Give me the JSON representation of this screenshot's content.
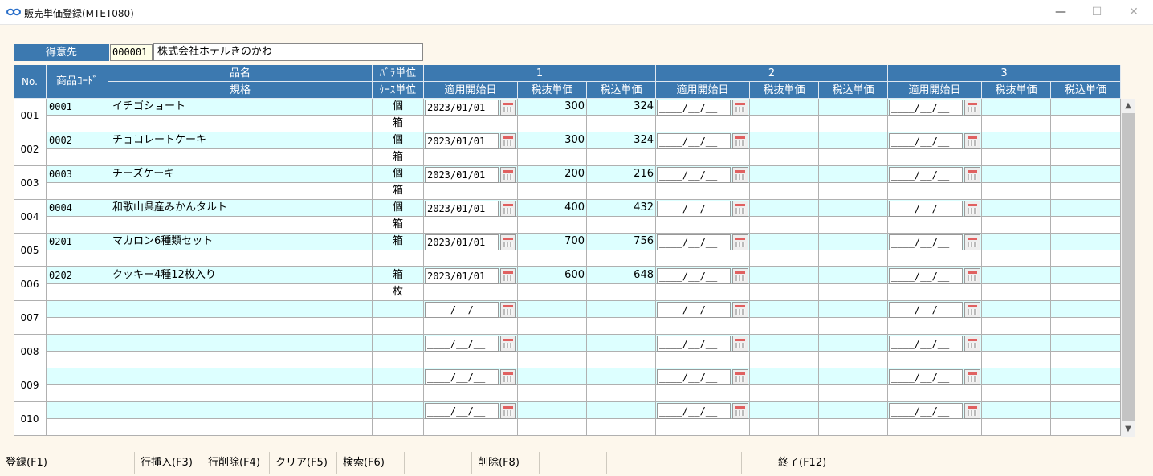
{
  "window": {
    "title": "販売単価登録(MTET080)",
    "min": "—",
    "max": "☐",
    "close": "✕"
  },
  "customer": {
    "label": "得意先",
    "code": "000001",
    "name": "株式会社ホテルきのかわ"
  },
  "headers": {
    "no": "No.",
    "code": "商品ｺｰﾄﾞ",
    "name": "品名",
    "spec": "規格",
    "unit_piece": "ﾊﾞﾗ単位",
    "unit_case": "ｹｰｽ単位",
    "groups": [
      "1",
      "2",
      "3"
    ],
    "start": "適用開始日",
    "ex_tax": "税抜単価",
    "in_tax": "税込単価"
  },
  "empty_date": "____/__/__",
  "rows": [
    {
      "no": "001",
      "code": "0001",
      "name": "イチゴショート",
      "spec": "",
      "unit1": "個",
      "unit2": "箱",
      "date1": "2023/01/01",
      "ex1": "300",
      "in1": "324"
    },
    {
      "no": "002",
      "code": "0002",
      "name": "チョコレートケーキ",
      "spec": "",
      "unit1": "個",
      "unit2": "箱",
      "date1": "2023/01/01",
      "ex1": "300",
      "in1": "324"
    },
    {
      "no": "003",
      "code": "0003",
      "name": "チーズケーキ",
      "spec": "",
      "unit1": "個",
      "unit2": "箱",
      "date1": "2023/01/01",
      "ex1": "200",
      "in1": "216"
    },
    {
      "no": "004",
      "code": "0004",
      "name": "和歌山県産みかんタルト",
      "spec": "",
      "unit1": "個",
      "unit2": "箱",
      "date1": "2023/01/01",
      "ex1": "400",
      "in1": "432"
    },
    {
      "no": "005",
      "code": "0201",
      "name": "マカロン6種類セット",
      "spec": "",
      "unit1": "箱",
      "unit2": "",
      "date1": "2023/01/01",
      "ex1": "700",
      "in1": "756"
    },
    {
      "no": "006",
      "code": "0202",
      "name": "クッキー4種12枚入り",
      "spec": "",
      "unit1": "箱",
      "unit2": "枚",
      "date1": "2023/01/01",
      "ex1": "600",
      "in1": "648"
    },
    {
      "no": "007",
      "code": "",
      "name": "",
      "spec": "",
      "unit1": "",
      "unit2": "",
      "date1": "",
      "ex1": "",
      "in1": ""
    },
    {
      "no": "008",
      "code": "",
      "name": "",
      "spec": "",
      "unit1": "",
      "unit2": "",
      "date1": "",
      "ex1": "",
      "in1": ""
    },
    {
      "no": "009",
      "code": "",
      "name": "",
      "spec": "",
      "unit1": "",
      "unit2": "",
      "date1": "",
      "ex1": "",
      "in1": ""
    },
    {
      "no": "010",
      "code": "",
      "name": "",
      "spec": "",
      "unit1": "",
      "unit2": "",
      "date1": "",
      "ex1": "",
      "in1": ""
    }
  ],
  "scroll": {
    "up": "▲",
    "down": "▼"
  },
  "fkeys": [
    "登録(F1)",
    "",
    "行挿入(F3)",
    "行削除(F4)",
    "クリア(F5)",
    "検索(F6)",
    "",
    "削除(F8)",
    "",
    "",
    "",
    "終了(F12)"
  ],
  "colors": {
    "header": "#3c79b0",
    "row_cyan": "#ddffff",
    "row_white": "#ffffff",
    "window_bg": "#fdf7ec"
  }
}
